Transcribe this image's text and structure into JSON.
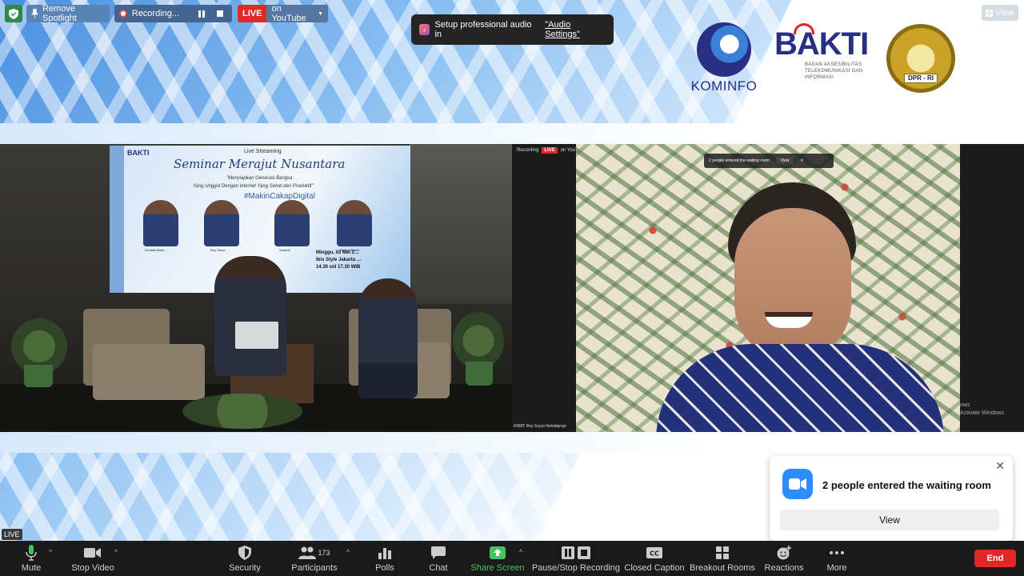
{
  "top_toolbar": {
    "spotlight_label": "Remove Spotlight",
    "recording_label": "Recording...",
    "live_label": "LIVE",
    "youtube_label": "on YouTube"
  },
  "audio_notification": {
    "text": "Setup professional audio in",
    "link": "\"Audio Settings\""
  },
  "view_button": "View",
  "logos": {
    "kominfo": "KOMINFO",
    "bakti": "BAKTI",
    "bakti_sub": "BADAN AKSESIBILITAS TELEKOMUNIKASI DAN INFORMASI",
    "dpr": "DPR - RI"
  },
  "left_video": {
    "banner_logo": "BAKTI",
    "live_streaming": "Live Streaming",
    "title": "Seminar Merajut Nusantara",
    "subtitle1": "\"Menyiapkan Generasi Bangsa",
    "subtitle2": "Yang Unggul Dengan Internet Yang Sehat dan Produktif\"",
    "hashtag": "#MakinCakapDigital",
    "speakers": [
      "Al-Hadi Abdul…",
      "Roy Suryo",
      "Suhardi",
      "Zaenal Abidin"
    ],
    "date_lines": [
      "Minggu, 02 Mei 2…",
      "Ibis Style Jakarta …",
      "14.30 s/d 17.30 WIB"
    ]
  },
  "right_video": {
    "mini_recording": "Recording",
    "mini_live": "LIVE",
    "mini_youtube": "on YouTube",
    "mini_note": "2 people entered the waiting room",
    "mini_view": "View",
    "participant_name": "KRMT Roy Suryo Notodiprojo",
    "watermark": "ows\nActivate Windows"
  },
  "live_badge": "LIVE",
  "waiting_popup": {
    "text": "2 people entered the waiting room",
    "view": "View"
  },
  "controls": {
    "mute": "Mute",
    "stop_video": "Stop Video",
    "security": "Security",
    "participants": "Participants",
    "participants_count": "173",
    "polls": "Polls",
    "chat": "Chat",
    "share_screen": "Share Screen",
    "pause_recording": "Pause/Stop Recording",
    "closed_caption": "Closed Caption",
    "breakout": "Breakout Rooms",
    "reactions": "Reactions",
    "more": "More",
    "end": "End"
  },
  "colors": {
    "live_red": "#e02a2a",
    "share_green": "#46c35b",
    "end_red": "#e02828",
    "zoom_blue": "#2d8cff",
    "bar_bg": "#1a1a1a"
  }
}
